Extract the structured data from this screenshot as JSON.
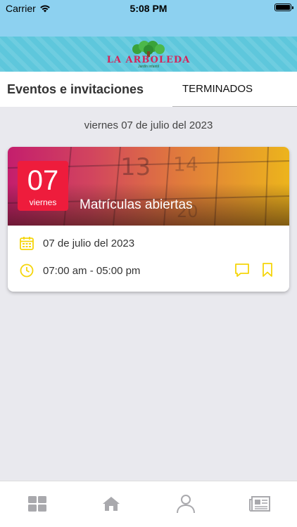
{
  "status_bar": {
    "carrier": "Carrier",
    "time": "5:08 PM"
  },
  "header": {
    "logo_text": "LA ARBOLEDA",
    "logo_sub": "Jardín infantil"
  },
  "tabs": {
    "current": "Eventos e invitaciones",
    "ended": "TERMINADOS"
  },
  "date_heading": "viernes 07 de julio del 2023",
  "event": {
    "day": "07",
    "weekday": "viernes",
    "title": "Matrículas abiertas",
    "date": "07 de julio del 2023",
    "time": "07:00 am - 05:00 pm"
  },
  "colors": {
    "accent_yellow": "#f5d50a",
    "badge_red": "#ee1c3c",
    "header_blue": "#5ec7dc"
  },
  "bottom_nav": {
    "icons": [
      "grid-icon",
      "home-icon",
      "user-icon",
      "newspaper-icon"
    ]
  }
}
